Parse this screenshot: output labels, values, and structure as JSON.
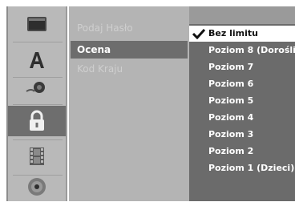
{
  "menu": {
    "items": [
      {
        "label": "Podaj Hasło",
        "state": "disabled"
      },
      {
        "label": "Ocena",
        "state": "selected"
      },
      {
        "label": "Kod Kraju",
        "state": "disabled"
      }
    ]
  },
  "rating_options": {
    "items": [
      {
        "label": "Bez limitu",
        "selected": true
      },
      {
        "label": "Poziom 8 (Dorośli"
      },
      {
        "label": "Poziom 7"
      },
      {
        "label": "Poziom 6"
      },
      {
        "label": "Poziom 5"
      },
      {
        "label": "Poziom 4"
      },
      {
        "label": "Poziom 3"
      },
      {
        "label": "Poziom 2"
      },
      {
        "label": "Poziom 1 (Dzieci)"
      }
    ]
  },
  "icons": [
    "display-icon",
    "font-icon",
    "audio-icon",
    "lock-icon",
    "film-icon",
    "disc-icon"
  ],
  "colors": {
    "rail_bg": "#b9b9b9",
    "rail_active": "#6e6e6e",
    "menu_bg": "#b4b4b4",
    "menu_selected": "#6d6d6d",
    "options_bg": "#6b6b6b",
    "option_selected_bg": "#ffffff"
  }
}
